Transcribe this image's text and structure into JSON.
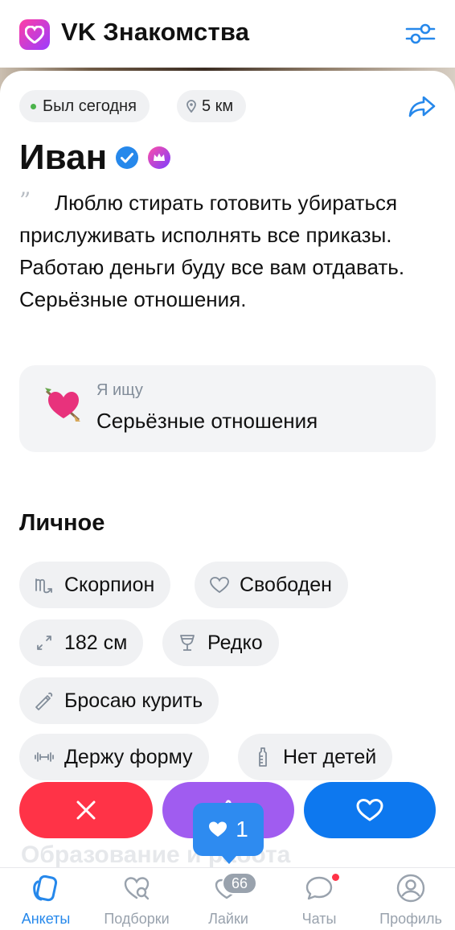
{
  "app": {
    "title": "VK Знакомства",
    "logo_icon": "heart-logo-icon",
    "filter_icon": "sliders-icon"
  },
  "colors": {
    "accent": "#2688eb",
    "dislike": "#ff3347",
    "superlike": "#a05cf0",
    "like": "#0d78ef",
    "online": "#4bb34b"
  },
  "profile": {
    "status": "Был сегодня",
    "distance": "5 км",
    "name": "Иван",
    "badges": [
      "verified-icon",
      "crown-icon"
    ],
    "bio": "Люблю стирать готовить убираться прислуживать исполнять все приказы. Работаю деньги буду все вам отдавать. Серьёзные отношения.",
    "looking_for": {
      "label": "Я ищу",
      "value": "Серьёзные отношения",
      "icon": "heart-arrow-emoji"
    }
  },
  "personal": {
    "title": "Личное",
    "tags": [
      {
        "icon": "scorpio-icon",
        "label": "Скорпион"
      },
      {
        "icon": "heart-outline-icon",
        "label": "Свободен"
      },
      {
        "icon": "height-arrows-icon",
        "label": "182 см"
      },
      {
        "icon": "wine-glass-icon",
        "label": "Редко"
      },
      {
        "icon": "cigarette-icon",
        "label": "Бросаю курить"
      },
      {
        "icon": "dumbbell-icon",
        "label": "Держу форму"
      },
      {
        "icon": "baby-bottle-icon",
        "label": "Нет детей"
      }
    ]
  },
  "actions": {
    "dislike_icon": "close-icon",
    "superlike_icon": "thumbs-up-icon",
    "like_icon": "heart-icon",
    "likes_toast_count": "1"
  },
  "peek_text": "Образование и работа",
  "nav": {
    "items": [
      {
        "label": "Анкеты",
        "icon": "cards-icon",
        "active": true
      },
      {
        "label": "Подборки",
        "icon": "heart-search-icon",
        "active": false
      },
      {
        "label": "Лайки",
        "icon": "hearts-icon",
        "active": false
      },
      {
        "label": "Чаты",
        "icon": "chat-bubble-icon",
        "active": false
      },
      {
        "label": "Профиль",
        "icon": "user-circle-icon",
        "active": false
      }
    ],
    "likes_badge": "66"
  }
}
